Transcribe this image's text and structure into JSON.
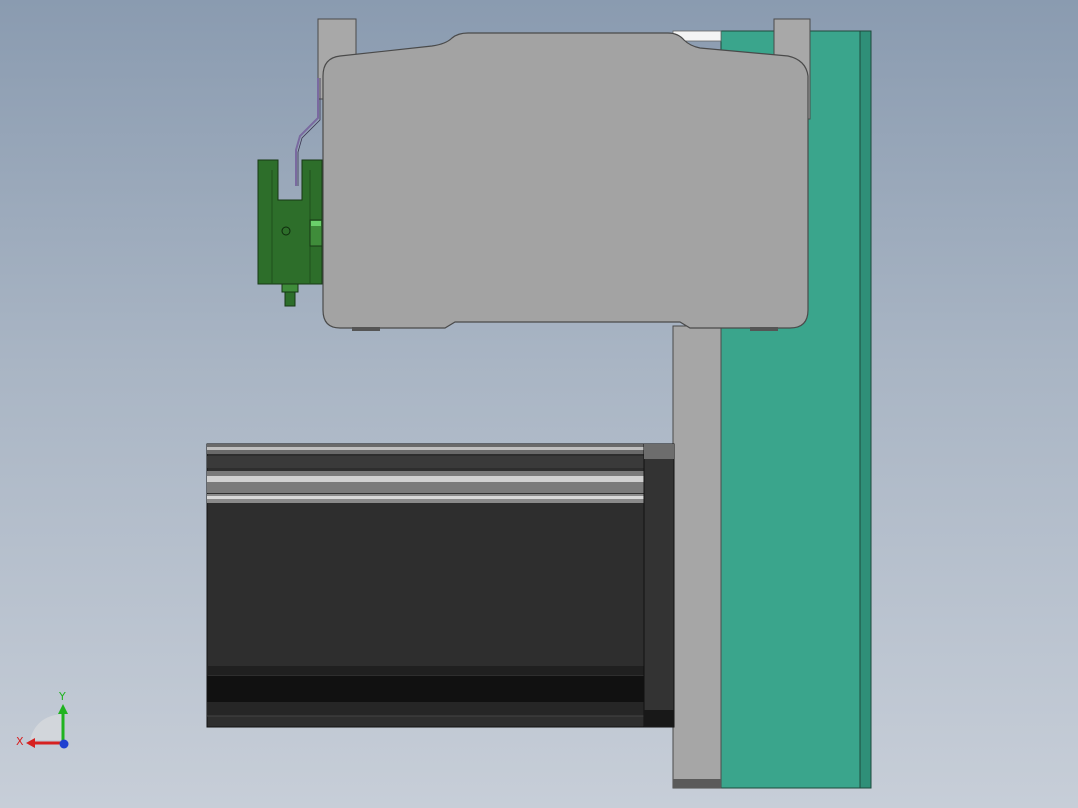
{
  "view": {
    "background_top": "#8a9bb0",
    "background_bottom": "#c7ced8"
  },
  "model": {
    "parts": [
      {
        "name": "linear-module-body",
        "color": "#a3a3a3"
      },
      {
        "name": "mounting-plate",
        "color": "#3aa58c"
      },
      {
        "name": "stepper-motor",
        "color": "#2d2d2d"
      },
      {
        "name": "limit-sensor",
        "color": "#2d6e2a"
      }
    ]
  },
  "triad": {
    "x_label": "X",
    "y_label": "Y",
    "x_color": "#d62020",
    "y_color": "#1fb31f",
    "z_color": "#2040d0"
  }
}
